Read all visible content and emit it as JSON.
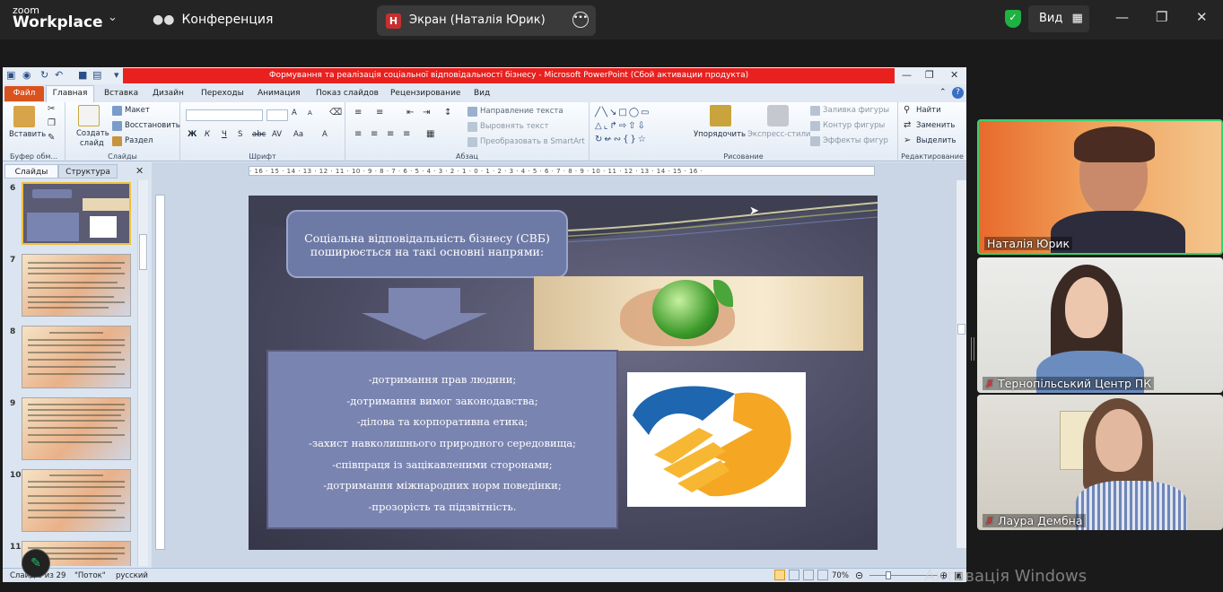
{
  "zoom": {
    "brand_top": "zoom",
    "brand_bottom": "Workplace",
    "conference_label": "Конференция",
    "screen_badge": "Н",
    "screen_label": "Экран (Наталія Юрик)",
    "view_label": "Вид",
    "icons": [
      "people-icon",
      "more-icon",
      "shield-icon",
      "grid-icon",
      "minimize-icon",
      "restore-icon",
      "close-icon"
    ],
    "accent_color": "#1fb141"
  },
  "ppt": {
    "window_title": "Формування та реалізація соціальної відповідальності бізнесу  -  Microsoft PowerPoint (Сбой активации продукта)",
    "tabs": [
      "Файл",
      "Главная",
      "Вставка",
      "Дизайн",
      "Переходы",
      "Анимация",
      "Показ слайдов",
      "Рецензирование",
      "Вид"
    ],
    "ribbon": {
      "clipboard": {
        "paste": "Вставить",
        "label": "Буфер обм..."
      },
      "slides": {
        "create": "Создать",
        "create2": "слайд",
        "layout": "Макет",
        "reset": "Восстановить",
        "section": "Раздел",
        "label": "Слайды"
      },
      "font": {
        "label": "Шрифт",
        "bold": "Ж",
        "italic": "К",
        "underline": "Ч",
        "strike": "S",
        "abc": "abc",
        "spacing": "AV",
        "case": "Aa",
        "color": "A",
        "grow": "A",
        "shrink": "A"
      },
      "paragraph": {
        "direction": "Направление текста",
        "align": "Выровнять текст",
        "smartart": "Преобразовать в SmartArt",
        "label": "Абзац"
      },
      "drawing": {
        "arrange": "Упорядочить",
        "styles": "Экспресс-стили",
        "fill": "Заливка фигуры",
        "outline": "Контур фигуры",
        "effects": "Эффекты фигур",
        "label": "Рисование"
      },
      "editing": {
        "find": "Найти",
        "replace": "Заменить",
        "select": "Выделить",
        "label": "Редактирование"
      }
    },
    "pane_tabs": [
      "Слайды",
      "Структура"
    ],
    "thumb_numbers": [
      "6",
      "7",
      "8",
      "9",
      "10",
      "11"
    ],
    "ruler_h": "· 16 · 15 · 14 · 13 · 12 · 11 · 10 · 9 · 8 · 7 · 6 · 5 · 4 · 3 · 2 · 1 · 0 · 1 · 2 · 3 · 4 · 5 · 6 · 7 · 8 · 9 · 10 · 11 · 12 · 13 · 14 · 15 · 16 ·",
    "slide": {
      "title_line1": "Соціальна відповідальність бізнесу (СВБ)",
      "title_line2": "поширюється на такі основні напрями:",
      "items": [
        "-дотримання прав людини;",
        "-дотримання вимог законодавства;",
        "-ділова та корпоративна  етика;",
        "-захист навколишнього природного середовища;",
        "-співпраця  із зацікавленими  сторонами;",
        "-дотримання  міжнародних норм поведінки;",
        "-прозорість та підзвітність."
      ]
    },
    "status": {
      "slide": "Слайд 6 из 29",
      "theme": "\"Поток\"",
      "lang": "русский",
      "zoom": "70%"
    }
  },
  "participants": [
    {
      "name": "Наталія Юрик",
      "muted": false
    },
    {
      "name": "Тернопільський Центр ПК",
      "muted": true
    },
    {
      "name": "Лаура Дембна",
      "muted": true
    }
  ],
  "overlay": {
    "windows_activation": "Активація Windows"
  }
}
